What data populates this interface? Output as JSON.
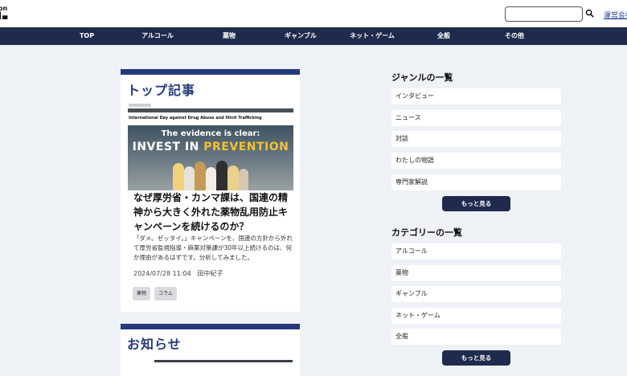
{
  "header": {
    "logo_line1": "on",
    "logo_line2": "▌▄",
    "search_placeholder": "",
    "search_icon": "search-icon",
    "corp_link": "運営会社"
  },
  "nav": {
    "items": [
      "TOP",
      "アルコール",
      "薬物",
      "ギャンブル",
      "ネット・ゲーム",
      "全般",
      "その他"
    ]
  },
  "top_articles": {
    "section_title": "トップ記事",
    "thumbnail": {
      "headline": "International Day against Drug Abuse and Illicit Trafficking",
      "line1": "The evidence is clear:",
      "line2a": "INVEST IN ",
      "line2b": "PREVENTION"
    },
    "title": "なぜ厚労省・カンマ課は、国連の精神から大きく外れた薬物乱用防止キャンペーンを続けるのか？",
    "description": "「ダメ。ゼッタイ。」キャンペーンを、国連の方針から外れて厚労省監視指導・麻薬対策課が30年以上続けるのは、何か理由があるはずです。分析してみました。",
    "date": "2024/07/28 11:04",
    "author": "田中紀子",
    "tags": [
      "薬物",
      "コラム"
    ]
  },
  "news": {
    "section_title": "お知らせ"
  },
  "genres": {
    "title": "ジャンルの一覧",
    "items": [
      "インタビュー",
      "ニュース",
      "対談",
      "わたしの物語",
      "専門家解説"
    ],
    "more": "もっと見る"
  },
  "categories": {
    "title": "カテゴリーの一覧",
    "items": [
      "アルコール",
      "薬物",
      "ギャンブル",
      "ネット・ゲーム",
      "全般"
    ],
    "more": "もっと見る"
  },
  "colors": {
    "nav_bg": "#1f2b4d",
    "accent": "#253a7a",
    "highlight": "#f2c230"
  }
}
